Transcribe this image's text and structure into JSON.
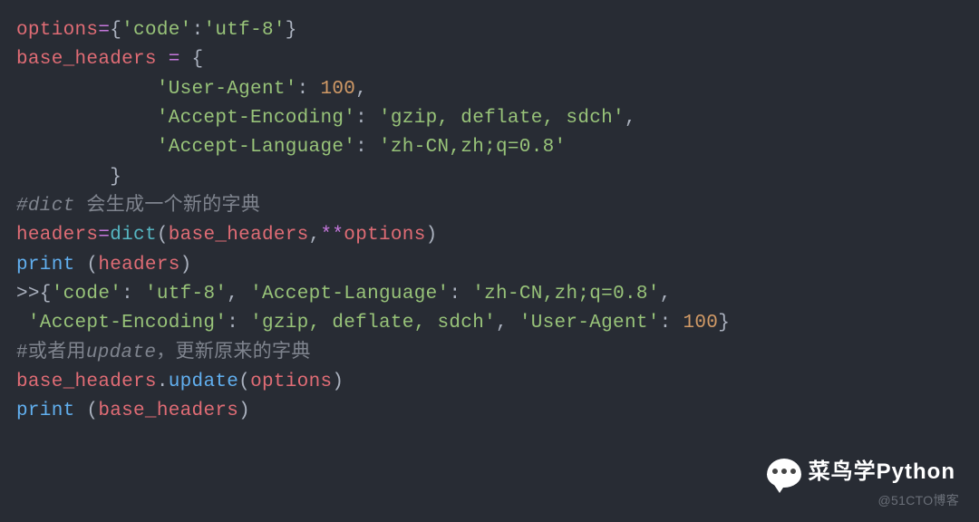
{
  "code": {
    "l1": {
      "var": "options",
      "eq": "=",
      "op": "{",
      "k": "'code'",
      "col": ":",
      "v": "'utf-8'",
      "cl": "}"
    },
    "l2": {
      "var": "base_headers",
      "eq": " = ",
      "op": "{"
    },
    "l3": {
      "indent": "            ",
      "k": "'User-Agent'",
      "col": ": ",
      "v": "100",
      "comma": ","
    },
    "l4": {
      "indent": "            ",
      "k": "'Accept-Encoding'",
      "col": ": ",
      "v": "'gzip, deflate, sdch'",
      "comma": ","
    },
    "l5": {
      "indent": "            ",
      "k": "'Accept-Language'",
      "col": ": ",
      "v": "'zh-CN,zh;q=0.8'"
    },
    "l6": {
      "indent": "        ",
      "close": "}"
    },
    "blank1": "",
    "l7": {
      "hash": "#",
      "kw": "dict",
      "rest": " 会生成一个新的字典"
    },
    "l8": {
      "var": "headers",
      "eq": "=",
      "fn": "dict",
      "op": "(",
      "a1": "base_headers",
      "comma": ",",
      "star": "**",
      "a2": "options",
      "cl": ")"
    },
    "l9": {
      "fn": "print",
      "sp": " ",
      "op": "(",
      "arg": "headers",
      "cl": ")"
    },
    "l10": {
      "p1": ">>{",
      "k1": "'code'",
      "c1": ": ",
      "v1": "'utf-8'",
      "s1": ", ",
      "k2": "'Accept-Language'",
      "c2": ": ",
      "v2": "'zh-CN,zh;q=0.8'",
      "s2": ","
    },
    "l11": {
      "sp": " ",
      "k1": "'Accept-Encoding'",
      "c1": ": ",
      "v1": "'gzip, deflate, sdch'",
      "s1": ", ",
      "k2": "'User-Agent'",
      "c2": ": ",
      "v2": "100",
      "close": "}"
    },
    "blank2": "",
    "l12": {
      "hash1": "#",
      "word1": "或者用",
      "kw": "update",
      "rest": "，更新原来的字典"
    },
    "l13": {
      "obj": "base_headers",
      "dot": ".",
      "fn": "update",
      "op": "(",
      "arg": "options",
      "cl": ")"
    },
    "l14": {
      "fn": "print",
      "sp": " ",
      "op": "(",
      "arg": "base_headers",
      "cl": ")"
    }
  },
  "watermark": {
    "brand": "菜鸟学Python",
    "source": "@51CTO博客"
  }
}
